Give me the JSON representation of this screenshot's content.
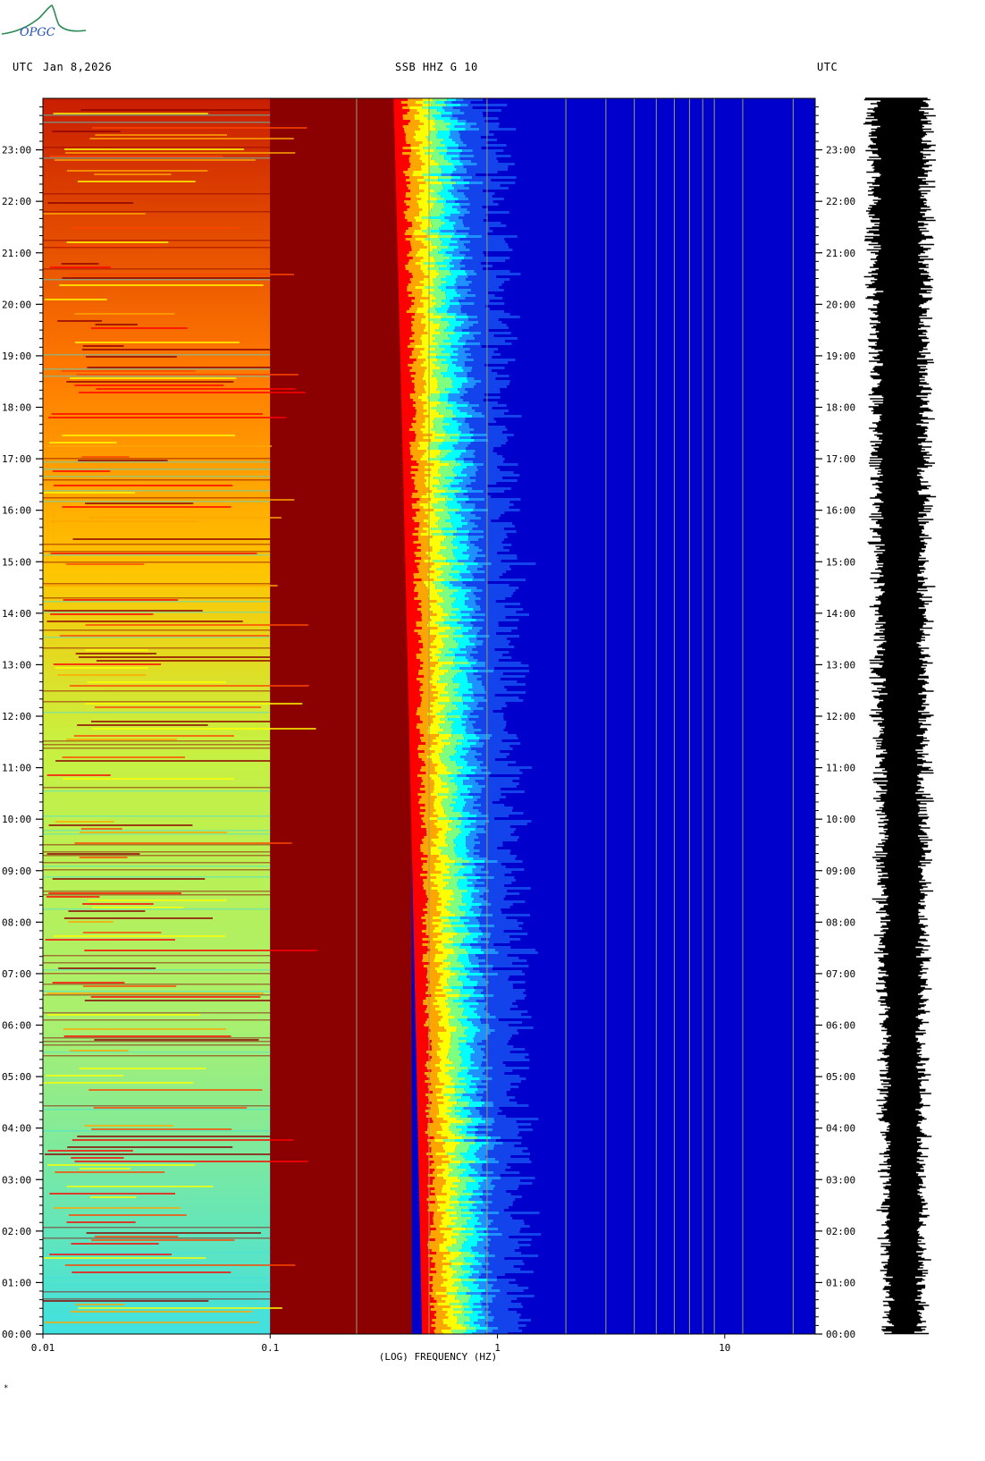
{
  "header": {
    "left_label": "UTC",
    "date": "Jan 8,2026",
    "station": "SSB HHZ G 10",
    "right_label": "UTC"
  },
  "logo": {
    "text": "OPGC"
  },
  "footer_mark": "*",
  "chart_data": {
    "type": "heatmap",
    "title": "SSB HHZ G 10",
    "xlabel": "(LOG) FREQUENCY (HZ)",
    "x_scale": "log",
    "xlim": [
      0.01,
      25
    ],
    "x_ticks": [
      {
        "value": 0.01,
        "label": "0.01"
      },
      {
        "value": 0.1,
        "label": "0.1"
      },
      {
        "value": 1,
        "label": "1"
      },
      {
        "value": 10,
        "label": "10"
      }
    ],
    "ylim_hours": [
      0,
      24
    ],
    "y_ticks": [
      "00:00",
      "01:00",
      "02:00",
      "03:00",
      "04:00",
      "05:00",
      "06:00",
      "07:00",
      "08:00",
      "09:00",
      "10:00",
      "11:00",
      "12:00",
      "13:00",
      "14:00",
      "15:00",
      "16:00",
      "17:00",
      "18:00",
      "19:00",
      "20:00",
      "21:00",
      "22:00",
      "23:00"
    ],
    "colormap": [
      "#00008b",
      "#0000cd",
      "#1e90ff",
      "#00ffff",
      "#7fff7f",
      "#ffff00",
      "#ffa500",
      "#ff0000",
      "#8b0000"
    ],
    "microseism_peak_hz": {
      "at_0h": 0.6,
      "at_24h": 0.45
    },
    "spectral_lines_hz": [
      0.24,
      0.5,
      0.9,
      2.0,
      3.0,
      4.0,
      5.0,
      6.0,
      7.0,
      8.0,
      9.0,
      12.0,
      20.0
    ],
    "seismogram": {
      "label": "waveform trace"
    }
  }
}
